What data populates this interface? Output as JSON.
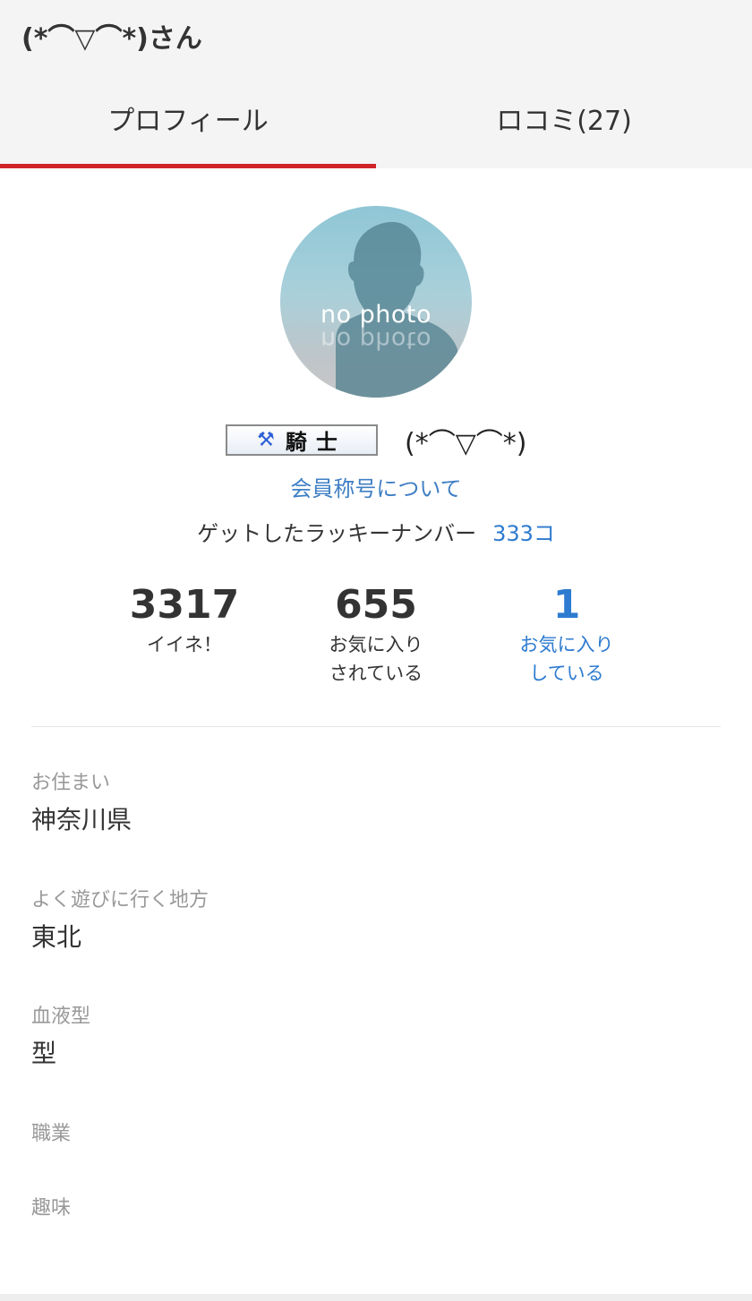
{
  "header": {
    "title": "(*⌒▽⌒*)さん"
  },
  "tabs": [
    {
      "label": "プロフィール",
      "active": true
    },
    {
      "label": "ロコミ(27)",
      "active": false
    }
  ],
  "profile": {
    "avatar_text": "no photo",
    "rank_icon": "crossed-axes-icon",
    "rank_label": "騎士",
    "nickname": "(*⌒▽⌒*)",
    "rank_link": "会員称号について",
    "lucky_label": "ゲットしたラッキーナンバー",
    "lucky_value": "333コ"
  },
  "stats": [
    {
      "value": "3317",
      "label": "イイネ！",
      "label2": ""
    },
    {
      "value": "655",
      "label": "お気に入り",
      "label2": "されている"
    },
    {
      "value": "1",
      "label": "お気に入り",
      "label2": "している"
    }
  ],
  "fields": [
    {
      "label": "お住まい",
      "value": "神奈川県"
    },
    {
      "label": "よく遊びに行く地方",
      "value": "東北"
    },
    {
      "label": "血液型",
      "value": "型"
    },
    {
      "label": "職業",
      "value": ""
    },
    {
      "label": "趣味",
      "value": ""
    }
  ],
  "colors": {
    "accent_red": "#d0232a",
    "link_blue": "#2d7bd0",
    "label_gray": "#999999"
  }
}
